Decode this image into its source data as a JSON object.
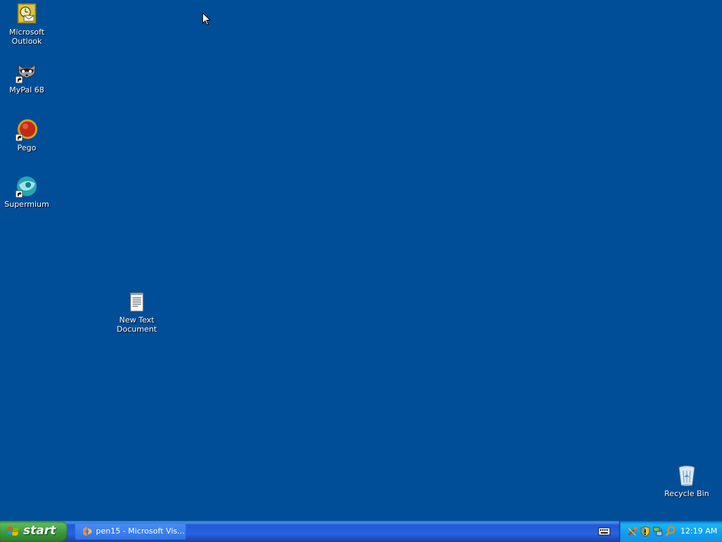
{
  "desktop": {
    "background_color": "#004e98",
    "icons": [
      {
        "label": "Microsoft\nOutlook",
        "icon": "outlook-icon"
      },
      {
        "label": "MyPal 68",
        "icon": "mypal-raccoon-icon"
      },
      {
        "label": "Pego",
        "icon": "pego-icon"
      },
      {
        "label": "Supermium",
        "icon": "supermium-icon"
      },
      {
        "label": "New Text\nDocument",
        "icon": "text-document-icon"
      },
      {
        "label": "Recycle Bin",
        "icon": "recycle-bin-icon"
      }
    ]
  },
  "taskbar": {
    "start_label": "start",
    "tasks": [
      {
        "label": "pen15 - Microsoft Vis...",
        "icon": "visual-studio-icon"
      }
    ],
    "language_bar_icon": "keyboard-icon",
    "tray_icons": [
      "tools-icon",
      "security-shield-icon",
      "network-icon",
      "search-icon"
    ],
    "clock": "12:19 AM"
  }
}
